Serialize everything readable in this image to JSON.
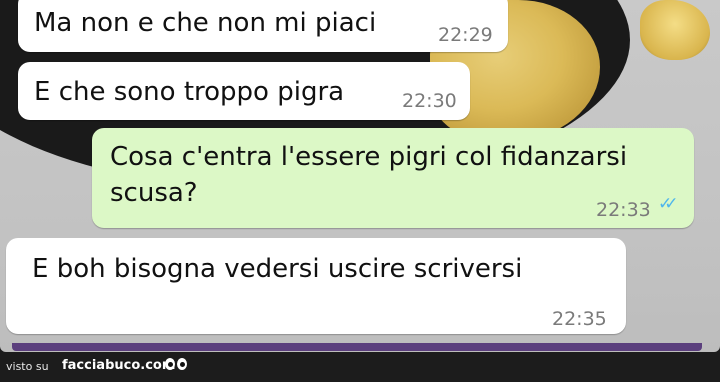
{
  "messages": [
    {
      "direction": "incoming",
      "text": "Ma non e che non mi piaci",
      "time": "22:29"
    },
    {
      "direction": "incoming",
      "text": "E che sono troppo pigra",
      "time": "22:30"
    },
    {
      "direction": "outgoing",
      "text_lines": [
        "Cosa c'entra l'essere pigri col fidanzarsi",
        "scusa?"
      ],
      "time": "22:33",
      "status": "read",
      "status_icon": "double-check-icon",
      "status_color": "#4fb6ec"
    },
    {
      "direction": "incoming",
      "text": "E boh bisogna vedersi uscire scriversi",
      "time": "22:35"
    }
  ],
  "colors": {
    "incoming_bubble": "#ffffff",
    "outgoing_bubble": "#dcf8c6",
    "timestamp": "#7a7a7a"
  },
  "credit": {
    "prefix": "visto su",
    "site": "facciabuco.com",
    "logo_icon": "eyes-logo-icon"
  }
}
